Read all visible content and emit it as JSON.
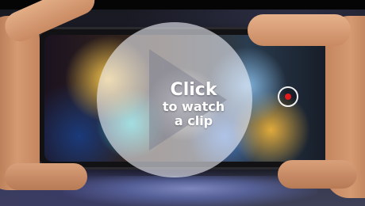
{
  "overlay": {
    "label_line1": "Click",
    "label_line2": "to watch",
    "label_line3": "a clip"
  },
  "icons": {
    "play": "play-icon",
    "record": "record-icon"
  },
  "colors": {
    "overlay_fill": "#ECEEF6",
    "record_dot": "#E11B1B"
  }
}
